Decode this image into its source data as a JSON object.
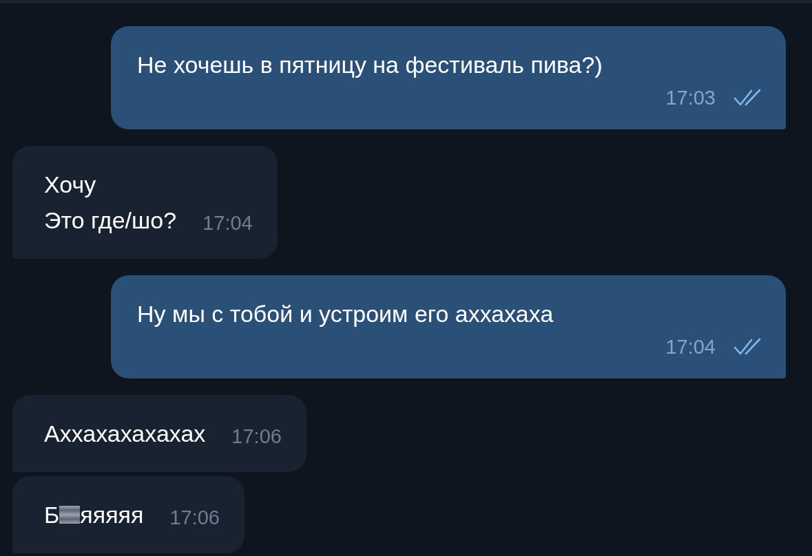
{
  "messages": [
    {
      "kind": "out",
      "lines": [
        "Не хочешь в пятницу на фестиваль пива?)"
      ],
      "time": "17:03",
      "read": true
    },
    {
      "kind": "in",
      "lines": [
        "Хочу",
        "Это где/шо?"
      ],
      "time": "17:04"
    },
    {
      "kind": "out",
      "lines": [
        "Ну мы с тобой и устроим его аххахаха"
      ],
      "time": "17:04",
      "read": true
    },
    {
      "kind": "in",
      "lines": [
        "Аххахахахахах"
      ],
      "time": "17:06"
    },
    {
      "kind": "in",
      "lines": [
        "Б",
        "яяяяя"
      ],
      "censored": true,
      "time": "17:06"
    }
  ]
}
